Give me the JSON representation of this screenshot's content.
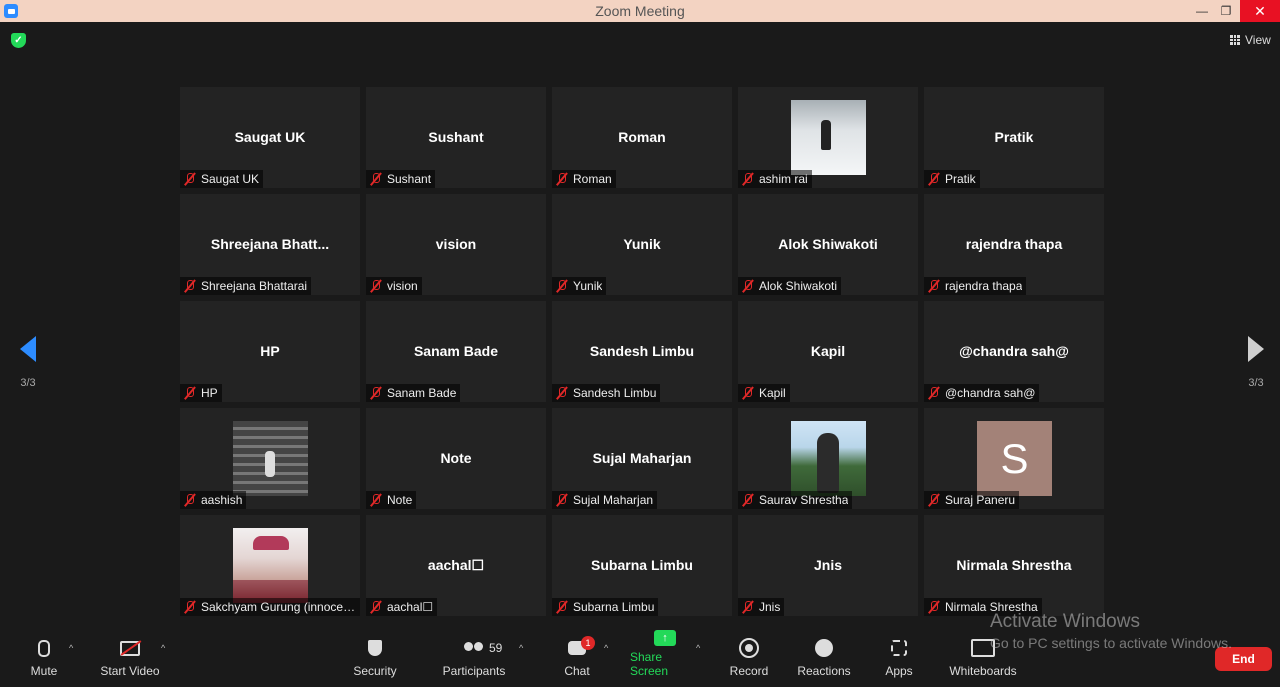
{
  "window": {
    "title": "Zoom Meeting"
  },
  "header": {
    "view_label": "View"
  },
  "pagination": {
    "left_page": "3/3",
    "right_page": "3/3"
  },
  "participants": [
    {
      "big": "Saugat UK",
      "label": "Saugat UK"
    },
    {
      "big": "Sushant",
      "label": "Sushant"
    },
    {
      "big": "Roman",
      "label": "Roman"
    },
    {
      "big": "",
      "label": "ashim rai",
      "photo": "photo-snow"
    },
    {
      "big": "Pratik",
      "label": "Pratik"
    },
    {
      "big": "Shreejana  Bhatt...",
      "label": "Shreejana Bhattarai"
    },
    {
      "big": "vision",
      "label": "vision"
    },
    {
      "big": "Yunik",
      "label": "Yunik"
    },
    {
      "big": "Alok Shiwakoti",
      "label": "Alok Shiwakoti"
    },
    {
      "big": "rajendra thapa",
      "label": "rajendra thapa"
    },
    {
      "big": "HP",
      "label": "HP"
    },
    {
      "big": "Sanam Bade",
      "label": "Sanam Bade"
    },
    {
      "big": "Sandesh Limbu",
      "label": "Sandesh Limbu"
    },
    {
      "big": "Kapil",
      "label": "Kapil"
    },
    {
      "big": "@chandra sah@",
      "label": "@chandra sah@"
    },
    {
      "big": "",
      "label": "aashish",
      "photo": "photo-stairs"
    },
    {
      "big": "Note",
      "label": "Note"
    },
    {
      "big": "Sujal Maharjan",
      "label": "Sujal Maharjan"
    },
    {
      "big": "",
      "label": "Saurav Shrestha",
      "photo": "photo-hill"
    },
    {
      "big": "",
      "label": "Suraj Paneru",
      "avatar": "S"
    },
    {
      "big": "",
      "label": "Sakchyam Gurung (innocen...",
      "photo": "photo-man"
    },
    {
      "big": "aachal☐",
      "label": "aachal☐"
    },
    {
      "big": "Subarna Limbu",
      "label": "Subarna Limbu"
    },
    {
      "big": "Jnis",
      "label": "Jnis"
    },
    {
      "big": "Nirmala Shrestha",
      "label": "Nirmala Shrestha"
    }
  ],
  "toolbar": {
    "mute": "Mute",
    "start_video": "Start Video",
    "security": "Security",
    "participants": "Participants",
    "participants_count": "59",
    "chat": "Chat",
    "chat_badge": "1",
    "share_screen": "Share Screen",
    "record": "Record",
    "reactions": "Reactions",
    "apps": "Apps",
    "whiteboards": "Whiteboards",
    "end": "End"
  },
  "watermark": {
    "line1": "Activate Windows",
    "line2": "Go to PC settings to activate Windows."
  },
  "colors": {
    "accent": "#2d8cff",
    "share_green": "#23d959",
    "end_red": "#e02828",
    "titlebar": "#f3d3c2"
  }
}
